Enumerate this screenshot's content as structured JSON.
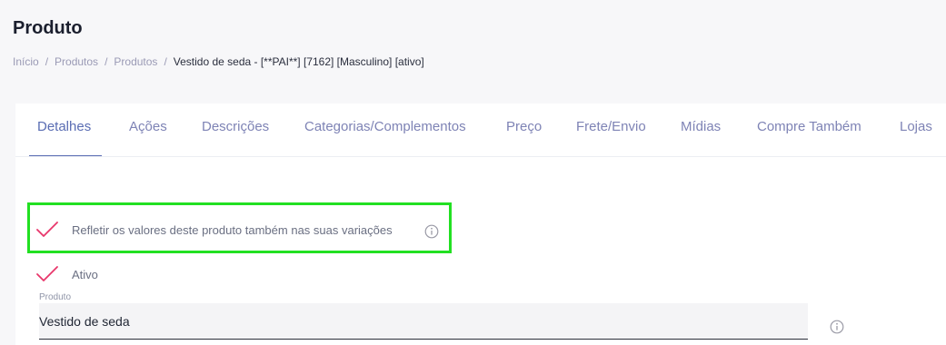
{
  "page": {
    "title": "Produto"
  },
  "breadcrumb": {
    "items": [
      "Início",
      "Produtos",
      "Produtos"
    ],
    "separator": "/",
    "current": "Vestido de seda - [**PAI**] [7162] [Masculino] [ativo]"
  },
  "tabs": [
    {
      "label": "Detalhes",
      "active": true
    },
    {
      "label": "Ações",
      "active": false
    },
    {
      "label": "Descrições",
      "active": false
    },
    {
      "label": "Categorias/Complementos",
      "active": false
    },
    {
      "label": "Preço",
      "active": false
    },
    {
      "label": "Frete/Envio",
      "active": false
    },
    {
      "label": "Mídias",
      "active": false
    },
    {
      "label": "Compre Também",
      "active": false
    },
    {
      "label": "Lojas",
      "active": false
    }
  ],
  "options": {
    "reflect_variations": {
      "label": "Refletir os valores deste produto também nas suas variações",
      "checked": true
    },
    "active": {
      "label": "Ativo",
      "checked": true
    }
  },
  "product_field": {
    "label": "Produto",
    "value": "Vestido de seda"
  },
  "colors": {
    "accent": "#5a6db3",
    "check": "#e8376b",
    "highlight": "#22e022"
  }
}
